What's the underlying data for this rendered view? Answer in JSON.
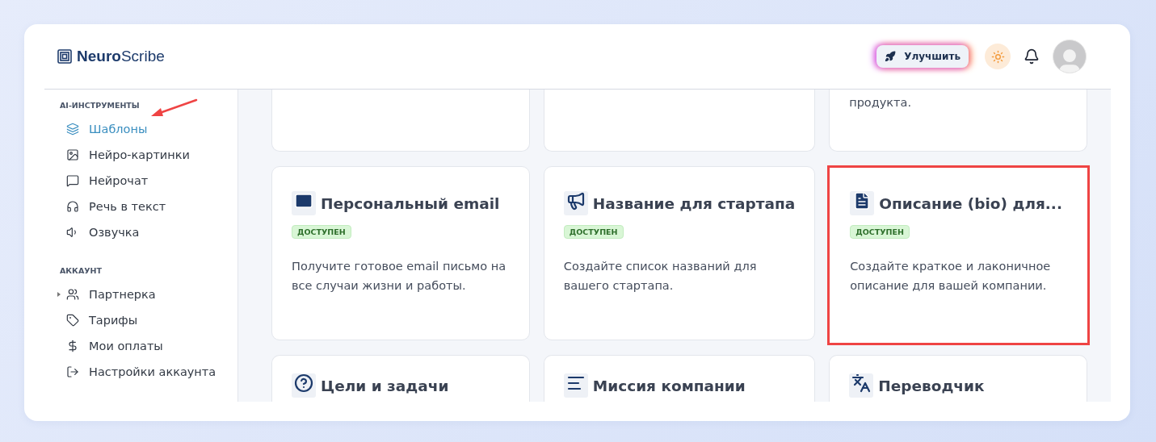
{
  "brand": {
    "bold": "Neuro",
    "light": "Scribe"
  },
  "header": {
    "upgrade_button": "Улучшить"
  },
  "sidebar": {
    "sections": [
      {
        "title": "AI-ИНСТРУМЕНТЫ",
        "items": [
          {
            "label": "Шаблоны",
            "selected": true,
            "expandable": false,
            "annotated": true
          },
          {
            "label": "Нейро-картинки",
            "selected": false,
            "expandable": false,
            "annotated": false
          },
          {
            "label": "Нейрочат",
            "selected": false,
            "expandable": false,
            "annotated": false
          },
          {
            "label": "Речь в текст",
            "selected": false,
            "expandable": false,
            "annotated": false
          },
          {
            "label": "Озвучка",
            "selected": false,
            "expandable": false,
            "annotated": false
          }
        ]
      },
      {
        "title": "АККАУНТ",
        "items": [
          {
            "label": "Партнерка",
            "selected": false,
            "expandable": true,
            "annotated": false
          },
          {
            "label": "Тарифы",
            "selected": false,
            "expandable": false,
            "annotated": false
          },
          {
            "label": "Мои оплаты",
            "selected": false,
            "expandable": false,
            "annotated": false
          },
          {
            "label": "Настройки аккаунта",
            "selected": false,
            "expandable": false,
            "annotated": false
          }
        ]
      }
    ]
  },
  "cards": [
    {
      "kind": "tail",
      "highlighted": false
    },
    {
      "kind": "tail",
      "highlighted": false
    },
    {
      "kind": "tail",
      "description": "продукта.",
      "highlighted": false
    },
    {
      "kind": "full",
      "title": "Персональный email",
      "badge": "ДОСТУПЕН",
      "description": "Получите готовое email письмо на все случаи жизни и работы.",
      "highlighted": false
    },
    {
      "kind": "full",
      "title": "Название для стартапа",
      "badge": "ДОСТУПЕН",
      "description": "Создайте список названий для вашего стартапа.",
      "highlighted": false
    },
    {
      "kind": "full",
      "title": "Описание (bio) для...",
      "badge": "ДОСТУПЕН",
      "description": "Создайте краткое и лаконичное описание для вашей компании.",
      "highlighted": true
    },
    {
      "kind": "head",
      "title": "Цели и задачи",
      "highlighted": false
    },
    {
      "kind": "head",
      "title": "Миссия компании",
      "highlighted": false
    },
    {
      "kind": "head",
      "title": "Переводчик",
      "highlighted": false
    }
  ]
}
